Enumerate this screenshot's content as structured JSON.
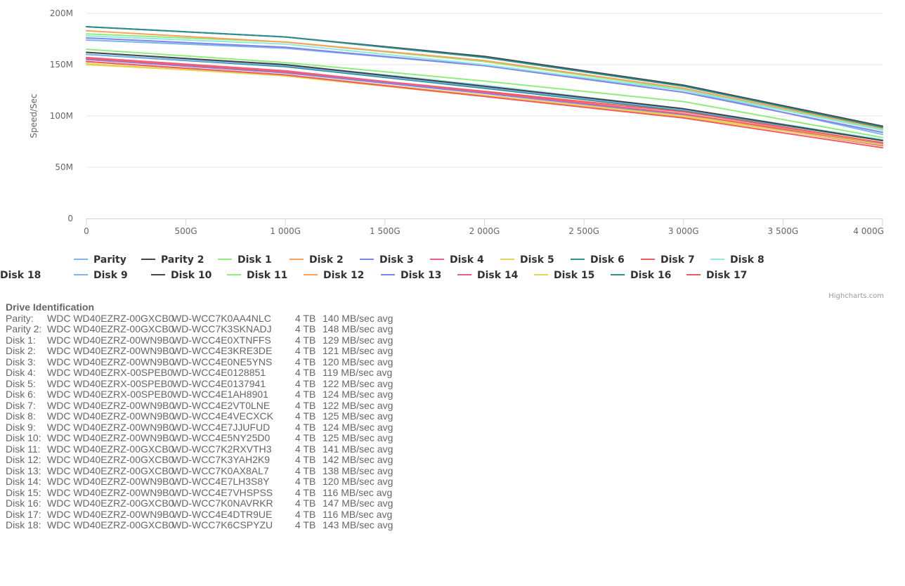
{
  "chart_data": {
    "type": "line",
    "ylabel": "Speed/Sec",
    "xlabel": "",
    "x": [
      0,
      1000,
      2000,
      3000,
      4000
    ],
    "x_unit": "G",
    "xlim": [
      0,
      4000
    ],
    "ylim": [
      0,
      200
    ],
    "y_unit": "M",
    "y_ticks": [
      "0",
      "50M",
      "100M",
      "150M",
      "200M"
    ],
    "x_ticks": [
      "0",
      "500G",
      "1 000G",
      "1 500G",
      "2 000G",
      "2 500G",
      "3 000G",
      "3 500G",
      "4 000G"
    ],
    "grid": true,
    "legend": "bottom",
    "credits": "Highcharts.com",
    "series": [
      {
        "name": "Parity",
        "color": "#7cb5ec",
        "values": [
          174,
          166,
          149,
          125,
          82
        ]
      },
      {
        "name": "Parity 2",
        "color": "#434348",
        "values": [
          187,
          177,
          158,
          130,
          90
        ]
      },
      {
        "name": "Disk 1",
        "color": "#90ed7d",
        "values": [
          165,
          152,
          134,
          114,
          79
        ]
      },
      {
        "name": "Disk 2",
        "color": "#f7a35c",
        "values": [
          155,
          143,
          123,
          102,
          73
        ]
      },
      {
        "name": "Disk 3",
        "color": "#8085e9",
        "values": [
          155,
          142,
          122,
          101,
          73
        ]
      },
      {
        "name": "Disk 4",
        "color": "#f15c80",
        "values": [
          153,
          140,
          120,
          100,
          71
        ]
      },
      {
        "name": "Disk 5",
        "color": "#e4d354",
        "values": [
          150,
          140,
          120,
          100,
          74
        ]
      },
      {
        "name": "Disk 6",
        "color": "#2b908f",
        "values": [
          160,
          148,
          127,
          105,
          76
        ]
      },
      {
        "name": "Disk 7",
        "color": "#f45b5b",
        "values": [
          156,
          143,
          124,
          104,
          74
        ]
      },
      {
        "name": "Disk 8",
        "color": "#91e8e1",
        "values": [
          162,
          150,
          130,
          107,
          77
        ]
      },
      {
        "name": "Disk 9",
        "color": "#7cb5ec",
        "values": [
          160,
          149,
          128,
          106,
          76
        ]
      },
      {
        "name": "Disk 10",
        "color": "#434348",
        "values": [
          162,
          150,
          129,
          107,
          76
        ]
      },
      {
        "name": "Disk 11",
        "color": "#90ed7d",
        "values": [
          180,
          172,
          153,
          126,
          87
        ]
      },
      {
        "name": "Disk 12",
        "color": "#f7a35c",
        "values": [
          183,
          172,
          154,
          127,
          88
        ]
      },
      {
        "name": "Disk 13",
        "color": "#8085e9",
        "values": [
          176,
          167,
          149,
          123,
          84
        ]
      },
      {
        "name": "Disk 14",
        "color": "#f15c80",
        "values": [
          157,
          144,
          123,
          102,
          72
        ]
      },
      {
        "name": "Disk 15",
        "color": "#e4d354",
        "values": [
          151,
          139,
          119,
          99,
          72
        ]
      },
      {
        "name": "Disk 16",
        "color": "#2b908f",
        "values": [
          187,
          177,
          157,
          129,
          89
        ]
      },
      {
        "name": "Disk 17",
        "color": "#f45b5b",
        "values": [
          153,
          140,
          119,
          98,
          69
        ]
      },
      {
        "name": "Disk 18",
        "color": "#91e8e1",
        "values": [
          178,
          170,
          150,
          125,
          86
        ]
      }
    ]
  },
  "drive_identification": {
    "title": "Drive Identification",
    "rows": [
      {
        "label": "Parity:",
        "model": "WDC WD40EZRZ-00GXCB0",
        "serial": "WD-WCC7K0AA4NLC",
        "size": "4 TB",
        "speed": "140 MB/sec avg"
      },
      {
        "label": "Parity 2:",
        "model": "WDC WD40EZRZ-00GXCB0",
        "serial": "WD-WCC7K3SKNADJ",
        "size": "4 TB",
        "speed": "148 MB/sec avg"
      },
      {
        "label": "Disk 1:",
        "model": "WDC WD40EZRZ-00WN9B0",
        "serial": "WD-WCC4E0XTNFFS",
        "size": "4 TB",
        "speed": "129 MB/sec avg"
      },
      {
        "label": "Disk 2:",
        "model": "WDC WD40EZRZ-00WN9B0",
        "serial": "WD-WCC4E3KRE3DE",
        "size": "4 TB",
        "speed": "121 MB/sec avg"
      },
      {
        "label": "Disk 3:",
        "model": "WDC WD40EZRZ-00WN9B0",
        "serial": "WD-WCC4E0NE5YNS",
        "size": "4 TB",
        "speed": "120 MB/sec avg"
      },
      {
        "label": "Disk 4:",
        "model": "WDC WD40EZRX-00SPEB0",
        "serial": "WD-WCC4E0128851",
        "size": "4 TB",
        "speed": "119 MB/sec avg"
      },
      {
        "label": "Disk 5:",
        "model": "WDC WD40EZRX-00SPEB0",
        "serial": "WD-WCC4E0137941",
        "size": "4 TB",
        "speed": "122 MB/sec avg"
      },
      {
        "label": "Disk 6:",
        "model": "WDC WD40EZRX-00SPEB0",
        "serial": "WD-WCC4E1AH8901",
        "size": "4 TB",
        "speed": "124 MB/sec avg"
      },
      {
        "label": "Disk 7:",
        "model": "WDC WD40EZRZ-00WN9B0",
        "serial": "WD-WCC4E2VT0LNE",
        "size": "4 TB",
        "speed": "122 MB/sec avg"
      },
      {
        "label": "Disk 8:",
        "model": "WDC WD40EZRZ-00WN9B0",
        "serial": "WD-WCC4E4VECXCK",
        "size": "4 TB",
        "speed": "125 MB/sec avg"
      },
      {
        "label": "Disk 9:",
        "model": "WDC WD40EZRZ-00WN9B0",
        "serial": "WD-WCC4E7JJUFUD",
        "size": "4 TB",
        "speed": "124 MB/sec avg"
      },
      {
        "label": "Disk 10:",
        "model": "WDC WD40EZRZ-00WN9B0",
        "serial": "WD-WCC4E5NY25D0",
        "size": "4 TB",
        "speed": "125 MB/sec avg"
      },
      {
        "label": "Disk 11:",
        "model": "WDC WD40EZRZ-00GXCB0",
        "serial": "WD-WCC7K2RXVTH3",
        "size": "4 TB",
        "speed": "141 MB/sec avg"
      },
      {
        "label": "Disk 12:",
        "model": "WDC WD40EZRZ-00GXCB0",
        "serial": "WD-WCC7K3YAH2K9",
        "size": "4 TB",
        "speed": "142 MB/sec avg"
      },
      {
        "label": "Disk 13:",
        "model": "WDC WD40EZRZ-00GXCB0",
        "serial": "WD-WCC7K0AX8AL7",
        "size": "4 TB",
        "speed": "138 MB/sec avg"
      },
      {
        "label": "Disk 14:",
        "model": "WDC WD40EZRZ-00WN9B0",
        "serial": "WD-WCC4E7LH3S8Y",
        "size": "4 TB",
        "speed": "120 MB/sec avg"
      },
      {
        "label": "Disk 15:",
        "model": "WDC WD40EZRZ-00WN9B0",
        "serial": "WD-WCC4E7VHSPSS",
        "size": "4 TB",
        "speed": "116 MB/sec avg"
      },
      {
        "label": "Disk 16:",
        "model": "WDC WD40EZRZ-00GXCB0",
        "serial": "WD-WCC7K0NAVRKR",
        "size": "4 TB",
        "speed": "147 MB/sec avg"
      },
      {
        "label": "Disk 17:",
        "model": "WDC WD40EZRZ-00WN9B0",
        "serial": "WD-WCC4E4DTR9UE",
        "size": "4 TB",
        "speed": "116 MB/sec avg"
      },
      {
        "label": "Disk 18:",
        "model": "WDC WD40EZRZ-00GXCB0",
        "serial": "WD-WCC7K6CSPYZU",
        "size": "4 TB",
        "speed": "143 MB/sec avg"
      }
    ]
  }
}
